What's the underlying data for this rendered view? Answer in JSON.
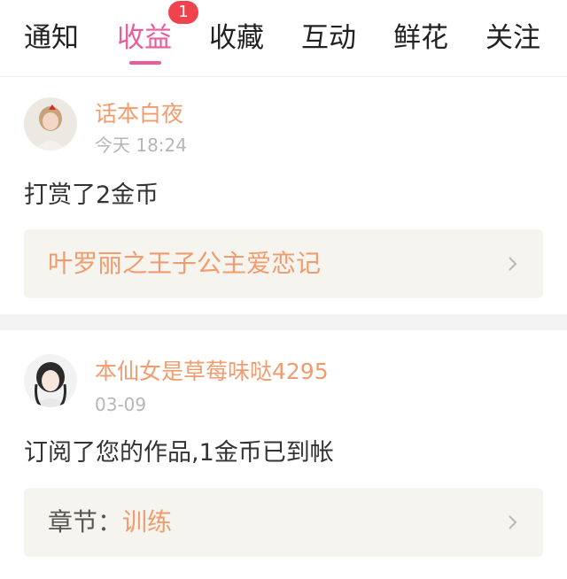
{
  "tabs": {
    "items": [
      {
        "label": "通知"
      },
      {
        "label": "收益"
      },
      {
        "label": "收藏"
      },
      {
        "label": "互动"
      },
      {
        "label": "鲜花"
      },
      {
        "label": "关注"
      }
    ],
    "active_index": 1,
    "badge": "1"
  },
  "feed": [
    {
      "user": "话本白夜",
      "time": "今天 18:24",
      "message": "打赏了2金币",
      "link_prefix": "",
      "link_title": "叶罗丽之王子公主爱恋记"
    },
    {
      "user": "本仙女是草莓味哒4295",
      "time": "03-09",
      "message": "订阅了您的作品,1金币已到帐",
      "link_prefix": "章节：",
      "link_title": "训练"
    }
  ],
  "colors": {
    "accent": "#e85d9a",
    "username": "#f09c6e",
    "badge": "#f0434d",
    "link_background": "#f5f4ef",
    "divider": "#f3f3f3"
  },
  "icons": {
    "link_arrow": "chevron-right-icon"
  }
}
